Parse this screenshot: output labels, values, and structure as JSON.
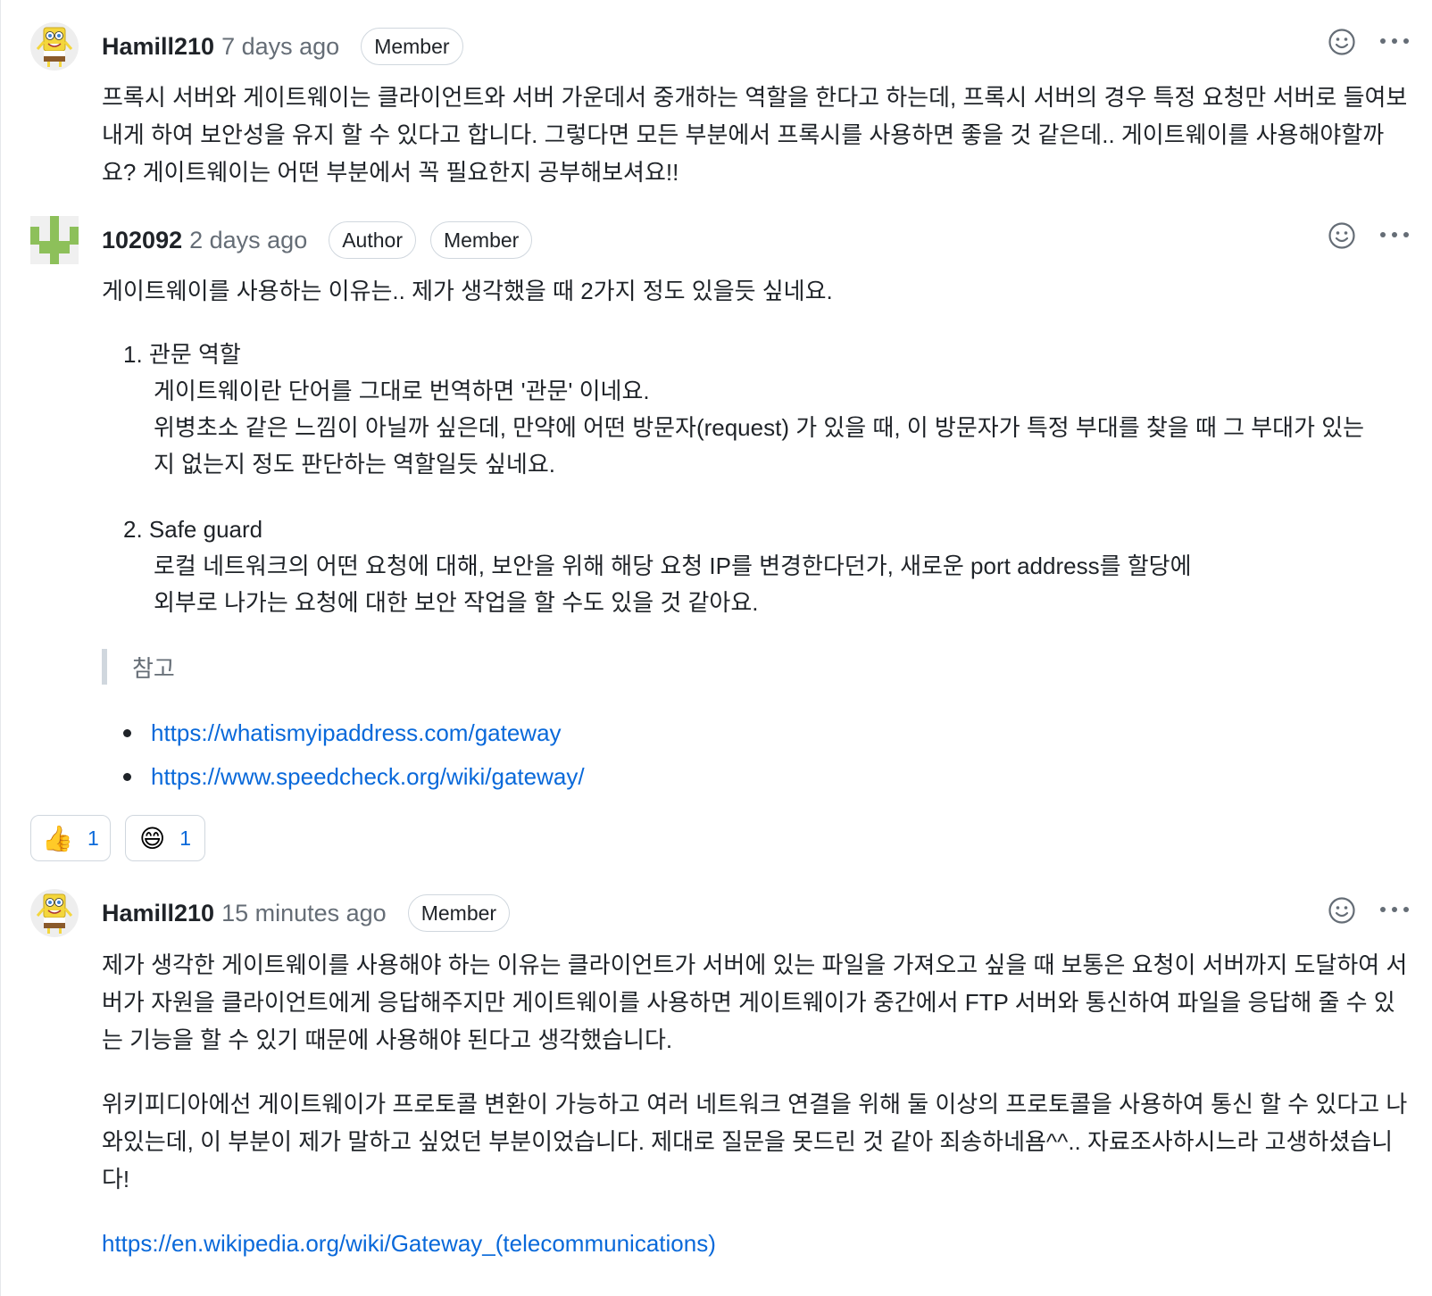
{
  "comments": [
    {
      "author": "Hamill210",
      "time": "7 days ago",
      "badges": [
        "Member"
      ],
      "paragraphs": [
        "프록시 서버와 게이트웨이는 클라이언트와 서버 가운데서 중개하는 역할을 한다고 하는데, 프록시 서버의 경우 특정 요청만 서버로 들여보내게 하여 보안성을 유지 할 수 있다고 합니다. 그렇다면 모든 부분에서 프록시를 사용하면 좋을 것 같은데.. 게이트웨이를 사용해야할까요? 게이트웨이는 어떤 부분에서 꼭 필요한지 공부해보셔요!!"
      ]
    },
    {
      "author": "102092",
      "time": "2 days ago",
      "badges": [
        "Author",
        "Member"
      ],
      "intro": "게이트웨이를 사용하는 이유는.. 제가 생각했을 때 2가지 정도 있을듯 싶네요.",
      "list": [
        {
          "title": "1. 관문 역할",
          "lines": [
            "게이트웨이란 단어를 그대로 번역하면 '관문' 이네요.",
            "위병초소 같은 느낌이 아닐까 싶은데, 만약에 어떤 방문자(request) 가 있을 때, 이 방문자가 특정 부대를 찾을 때 그 부대가 있는",
            "지 없는지 정도 판단하는 역할일듯 싶네요."
          ]
        },
        {
          "title": "2. Safe guard",
          "lines": [
            "로컬 네트워크의 어떤 요청에 대해, 보안을 위해 해당 요청 IP를 변경한다던가, 새로운 port address를 할당에",
            "외부로 나가는 요청에 대한 보안 작업을 할 수도 있을 것 같아요."
          ]
        }
      ],
      "quote": "참고",
      "links": [
        "https://whatismyipaddress.com/gateway",
        "https://www.speedcheck.org/wiki/gateway/"
      ],
      "reactions": [
        {
          "emoji": "👍",
          "icon": "thumbs-up-icon",
          "count": "1"
        },
        {
          "emoji": "😄",
          "icon": "grinning-face-icon",
          "count": "1"
        }
      ]
    },
    {
      "author": "Hamill210",
      "time": "15 minutes ago",
      "badges": [
        "Member"
      ],
      "paragraphs": [
        "제가 생각한 게이트웨이를 사용해야 하는 이유는 클라이언트가 서버에 있는 파일을 가져오고 싶을 때 보통은 요청이 서버까지 도달하여 서버가 자원을 클라이언트에게 응답해주지만 게이트웨이를 사용하면 게이트웨이가 중간에서 FTP 서버와 통신하여 파일을 응답해 줄 수 있는 기능을 할 수 있기 때문에 사용해야 된다고 생각했습니다.",
        "위키피디아에선 게이트웨이가 프로토콜 변환이 가능하고 여러 네트워크 연결을 위해 둘 이상의 프로토콜을 사용하여 통신 할 수 있다고 나와있는데, 이 부분이 제가 말하고 싶었던 부분이었습니다. 제대로 질문을 못드린 것 같아 죄송하네욤^^.. 자료조사하시느라 고생하셨습니다!"
      ],
      "link": "https://en.wikipedia.org/wiki/Gateway_(telecommunications)"
    }
  ],
  "icons": {
    "add_reaction": "smiley-icon",
    "more_options": "kebab-horizontal-icon",
    "avatar_sponge": "sponge-character-avatar",
    "avatar_identicon": "identicon-avatar"
  },
  "colors": {
    "link": "#0969da",
    "muted": "#656d76",
    "border": "#d0d7de",
    "identicon": "#8dc05a"
  }
}
